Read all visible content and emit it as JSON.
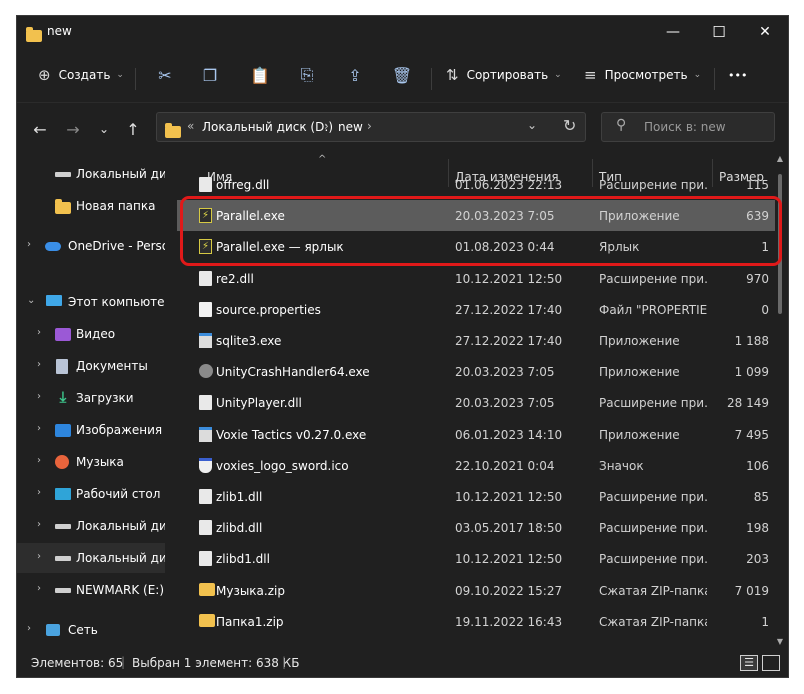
{
  "window": {
    "title": "new",
    "minimize": "—",
    "maximize": "☐",
    "close": "✕"
  },
  "toolbar": {
    "new_label": "Создать",
    "sort_label": "Сортировать",
    "view_label": "Просмотреть",
    "more_label": "•••"
  },
  "address": {
    "prefix": "«",
    "drive": "Локальный диск (D:)",
    "folder": "new",
    "separator": "›"
  },
  "search": {
    "placeholder": "Поиск в: new"
  },
  "sidebar": {
    "items": [
      {
        "label": "Локальный ди",
        "icon": "drive-icon"
      },
      {
        "label": "Новая папка",
        "icon": "folder-icon"
      },
      {
        "label": "OneDrive - Perso",
        "icon": "cloud-icon"
      },
      {
        "label": "Этот компьютер",
        "icon": "computer-icon"
      },
      {
        "label": "Видео",
        "icon": "video-icon"
      },
      {
        "label": "Документы",
        "icon": "documents-icon"
      },
      {
        "label": "Загрузки",
        "icon": "downloads-icon"
      },
      {
        "label": "Изображения",
        "icon": "pictures-icon"
      },
      {
        "label": "Музыка",
        "icon": "music-icon"
      },
      {
        "label": "Рабочий стол",
        "icon": "desktop-icon"
      },
      {
        "label": "Локальный ди",
        "icon": "drive-icon"
      },
      {
        "label": "Локальный ди",
        "icon": "drive-icon"
      },
      {
        "label": "NEWMARK (E:)",
        "icon": "drive-icon"
      },
      {
        "label": "Сеть",
        "icon": "network-icon"
      }
    ]
  },
  "columns": {
    "name": "Имя",
    "date": "Дата изменения",
    "type": "Тип",
    "size": "Размер"
  },
  "files": [
    {
      "name": "offreg.dll",
      "date": "01.06.2023 22:13",
      "type": "Расширение при...",
      "size": "115",
      "icon": "dll-icon"
    },
    {
      "name": "Parallel.exe",
      "date": "20.03.2023 7:05",
      "type": "Приложение",
      "size": "639",
      "icon": "app-icon"
    },
    {
      "name": "Parallel.exe — ярлык",
      "date": "01.08.2023 0:44",
      "type": "Ярлык",
      "size": "1",
      "icon": "shortcut-icon"
    },
    {
      "name": "re2.dll",
      "date": "10.12.2021 12:50",
      "type": "Расширение при...",
      "size": "970",
      "icon": "dll-icon"
    },
    {
      "name": "source.properties",
      "date": "27.12.2022 17:40",
      "type": "Файл \"PROPERTIES\"",
      "size": "0",
      "icon": "file-icon"
    },
    {
      "name": "sqlite3.exe",
      "date": "27.12.2022 17:40",
      "type": "Приложение",
      "size": "1 188",
      "icon": "exe-icon"
    },
    {
      "name": "UnityCrashHandler64.exe",
      "date": "20.03.2023 7:05",
      "type": "Приложение",
      "size": "1 099",
      "icon": "unity-icon"
    },
    {
      "name": "UnityPlayer.dll",
      "date": "20.03.2023 7:05",
      "type": "Расширение при...",
      "size": "28 149",
      "icon": "dll-icon"
    },
    {
      "name": "Voxie Tactics v0.27.0.exe",
      "date": "06.01.2023 14:10",
      "type": "Приложение",
      "size": "7 495",
      "icon": "exe-icon"
    },
    {
      "name": "voxies_logo_sword.ico",
      "date": "22.10.2021 0:04",
      "type": "Значок",
      "size": "106",
      "icon": "ico-icon"
    },
    {
      "name": "zlib1.dll",
      "date": "10.12.2021 12:50",
      "type": "Расширение при...",
      "size": "85",
      "icon": "dll-icon"
    },
    {
      "name": "zlibd.dll",
      "date": "03.05.2017 18:50",
      "type": "Расширение при...",
      "size": "198",
      "icon": "dll-icon"
    },
    {
      "name": "zlibd1.dll",
      "date": "10.12.2021 12:50",
      "type": "Расширение при...",
      "size": "203",
      "icon": "dll-icon"
    },
    {
      "name": "Музыка.zip",
      "date": "09.10.2022 15:27",
      "type": "Сжатая ZIP-папка",
      "size": "7 019",
      "icon": "zip-icon"
    },
    {
      "name": "Папка1.zip",
      "date": "19.11.2022 16:43",
      "type": "Сжатая ZIP-папка",
      "size": "1",
      "icon": "zip-icon"
    }
  ],
  "status": {
    "count": "Элементов: 65",
    "selection": "Выбран 1 элемент: 638 КБ",
    "divider": "|"
  },
  "colors": {
    "highlight": "#e01919",
    "background": "#202020",
    "selected_row": "#5c5c5c",
    "folder": "#f2c14e"
  }
}
